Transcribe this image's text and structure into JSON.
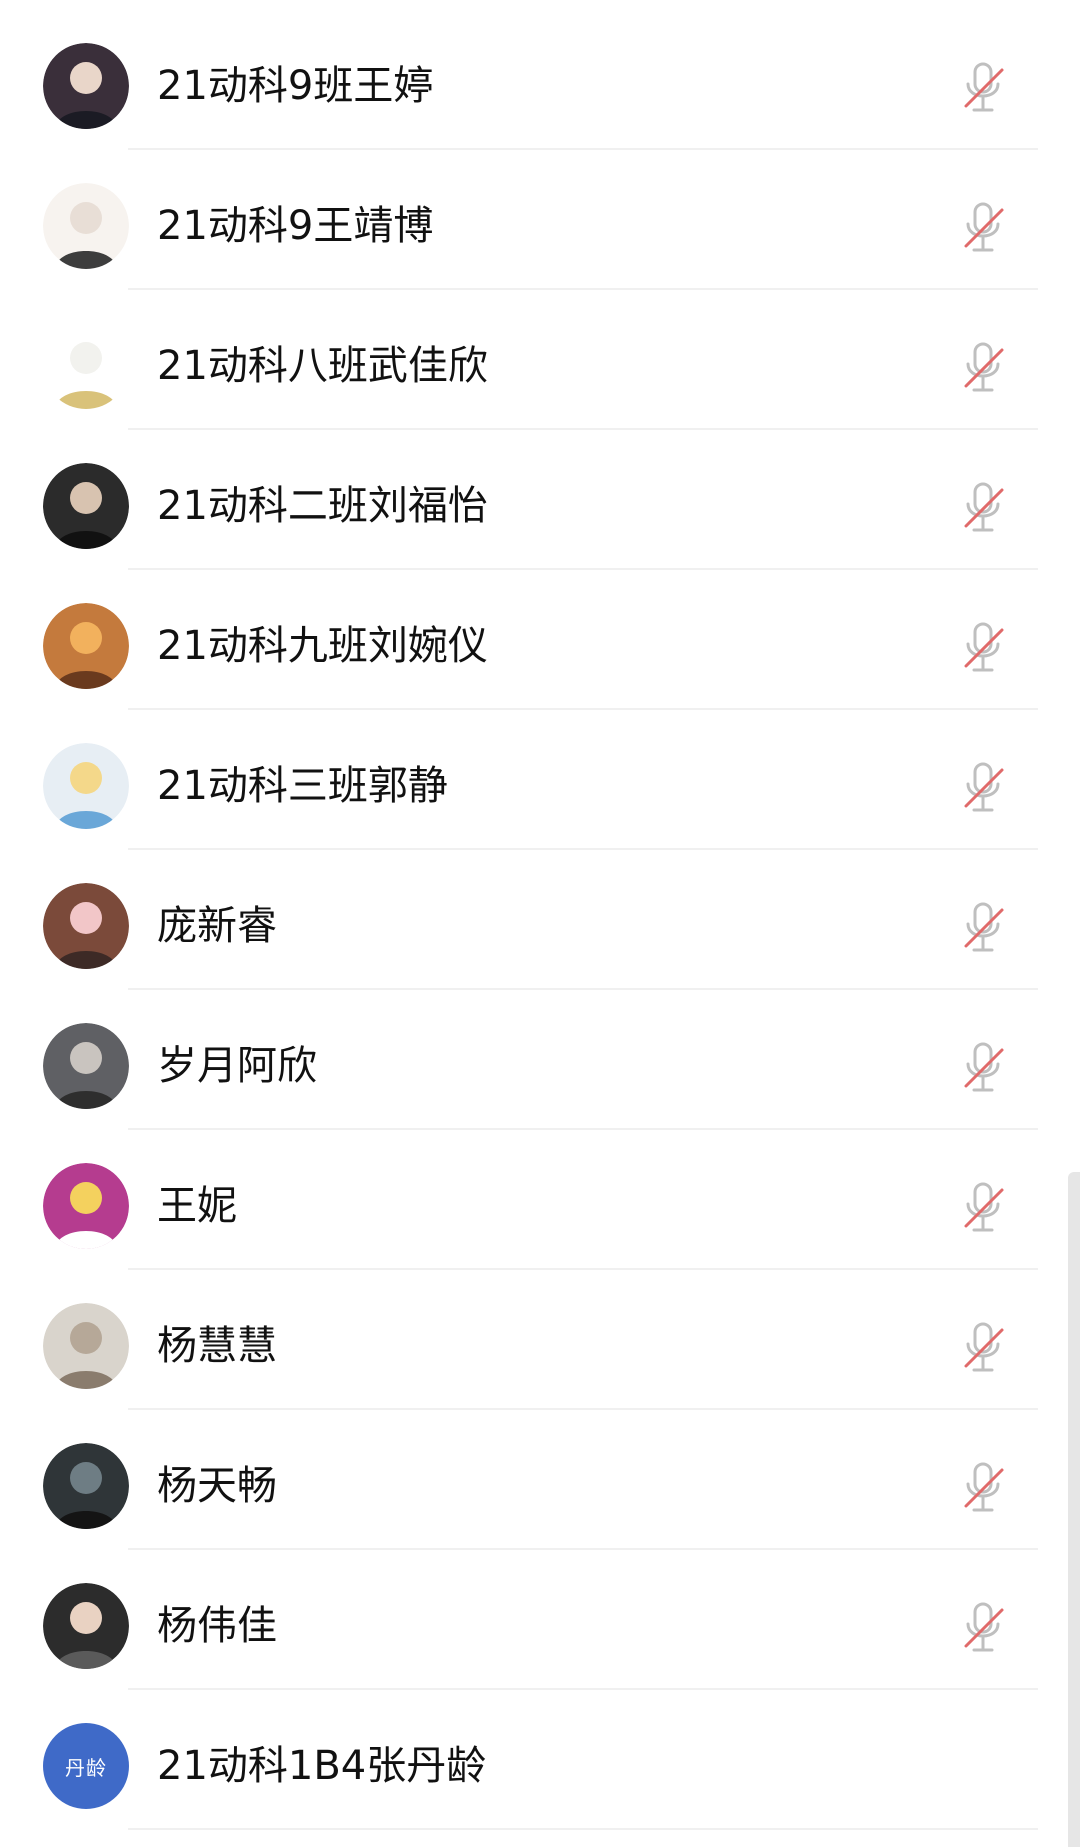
{
  "members": [
    {
      "name": "21动科9班王婷",
      "muted": true,
      "avatar": {
        "type": "photo",
        "colors": [
          "#3a2f3a",
          "#e9d6c9",
          "#1b1b24"
        ]
      }
    },
    {
      "name": "21动科9王靖博",
      "muted": true,
      "avatar": {
        "type": "illustration",
        "colors": [
          "#f7f3ef",
          "#e8ded6",
          "#3d3d3d"
        ]
      }
    },
    {
      "name": "21动科八班武佳欣",
      "muted": true,
      "avatar": {
        "type": "illustration",
        "colors": [
          "#ffffff",
          "#f2f2ee",
          "#d9c27a"
        ]
      }
    },
    {
      "name": "21动科二班刘福怡",
      "muted": true,
      "avatar": {
        "type": "photo",
        "colors": [
          "#2b2b2b",
          "#d8c3b0",
          "#111111"
        ]
      }
    },
    {
      "name": "21动科九班刘婉仪",
      "muted": true,
      "avatar": {
        "type": "photo",
        "colors": [
          "#c47a3d",
          "#f2b15d",
          "#6a3a1e"
        ]
      }
    },
    {
      "name": "21动科三班郭静",
      "muted": true,
      "avatar": {
        "type": "illustration",
        "colors": [
          "#e7eef4",
          "#f4d88a",
          "#6aa7d8"
        ]
      }
    },
    {
      "name": "庞新睿",
      "muted": true,
      "avatar": {
        "type": "photo",
        "colors": [
          "#7b4a3a",
          "#f2c6c8",
          "#3d2a26"
        ]
      }
    },
    {
      "name": "岁月阿欣",
      "muted": true,
      "avatar": {
        "type": "photo",
        "colors": [
          "#5f6064",
          "#c9c4bf",
          "#2e2e2e"
        ]
      }
    },
    {
      "name": "王妮",
      "muted": true,
      "avatar": {
        "type": "illustration",
        "colors": [
          "#b53c8f",
          "#f4d15e",
          "#ffffff"
        ]
      }
    },
    {
      "name": "杨慧慧",
      "muted": true,
      "avatar": {
        "type": "photo",
        "colors": [
          "#d9d4cc",
          "#b6a898",
          "#8a7c6d"
        ]
      }
    },
    {
      "name": "杨天畅",
      "muted": true,
      "avatar": {
        "type": "photo",
        "colors": [
          "#2f3538",
          "#6e7d84",
          "#141414"
        ]
      }
    },
    {
      "name": "杨伟佳",
      "muted": true,
      "avatar": {
        "type": "illustration",
        "colors": [
          "#2c2c2c",
          "#e9d2c2",
          "#5a5a5a"
        ]
      }
    },
    {
      "name": "21动科1B4张丹龄",
      "muted": false,
      "avatar": {
        "type": "text",
        "text": "丹龄",
        "colors": [
          "#3f6ac8",
          "#3f6ac8",
          "#ffffff"
        ]
      }
    }
  ],
  "icons": {
    "mic_muted": "microphone-muted-icon"
  },
  "colors": {
    "mic_gray": "#bfbfbf",
    "mute_slash": "#e06a6a",
    "divider": "#f0f0f0"
  }
}
